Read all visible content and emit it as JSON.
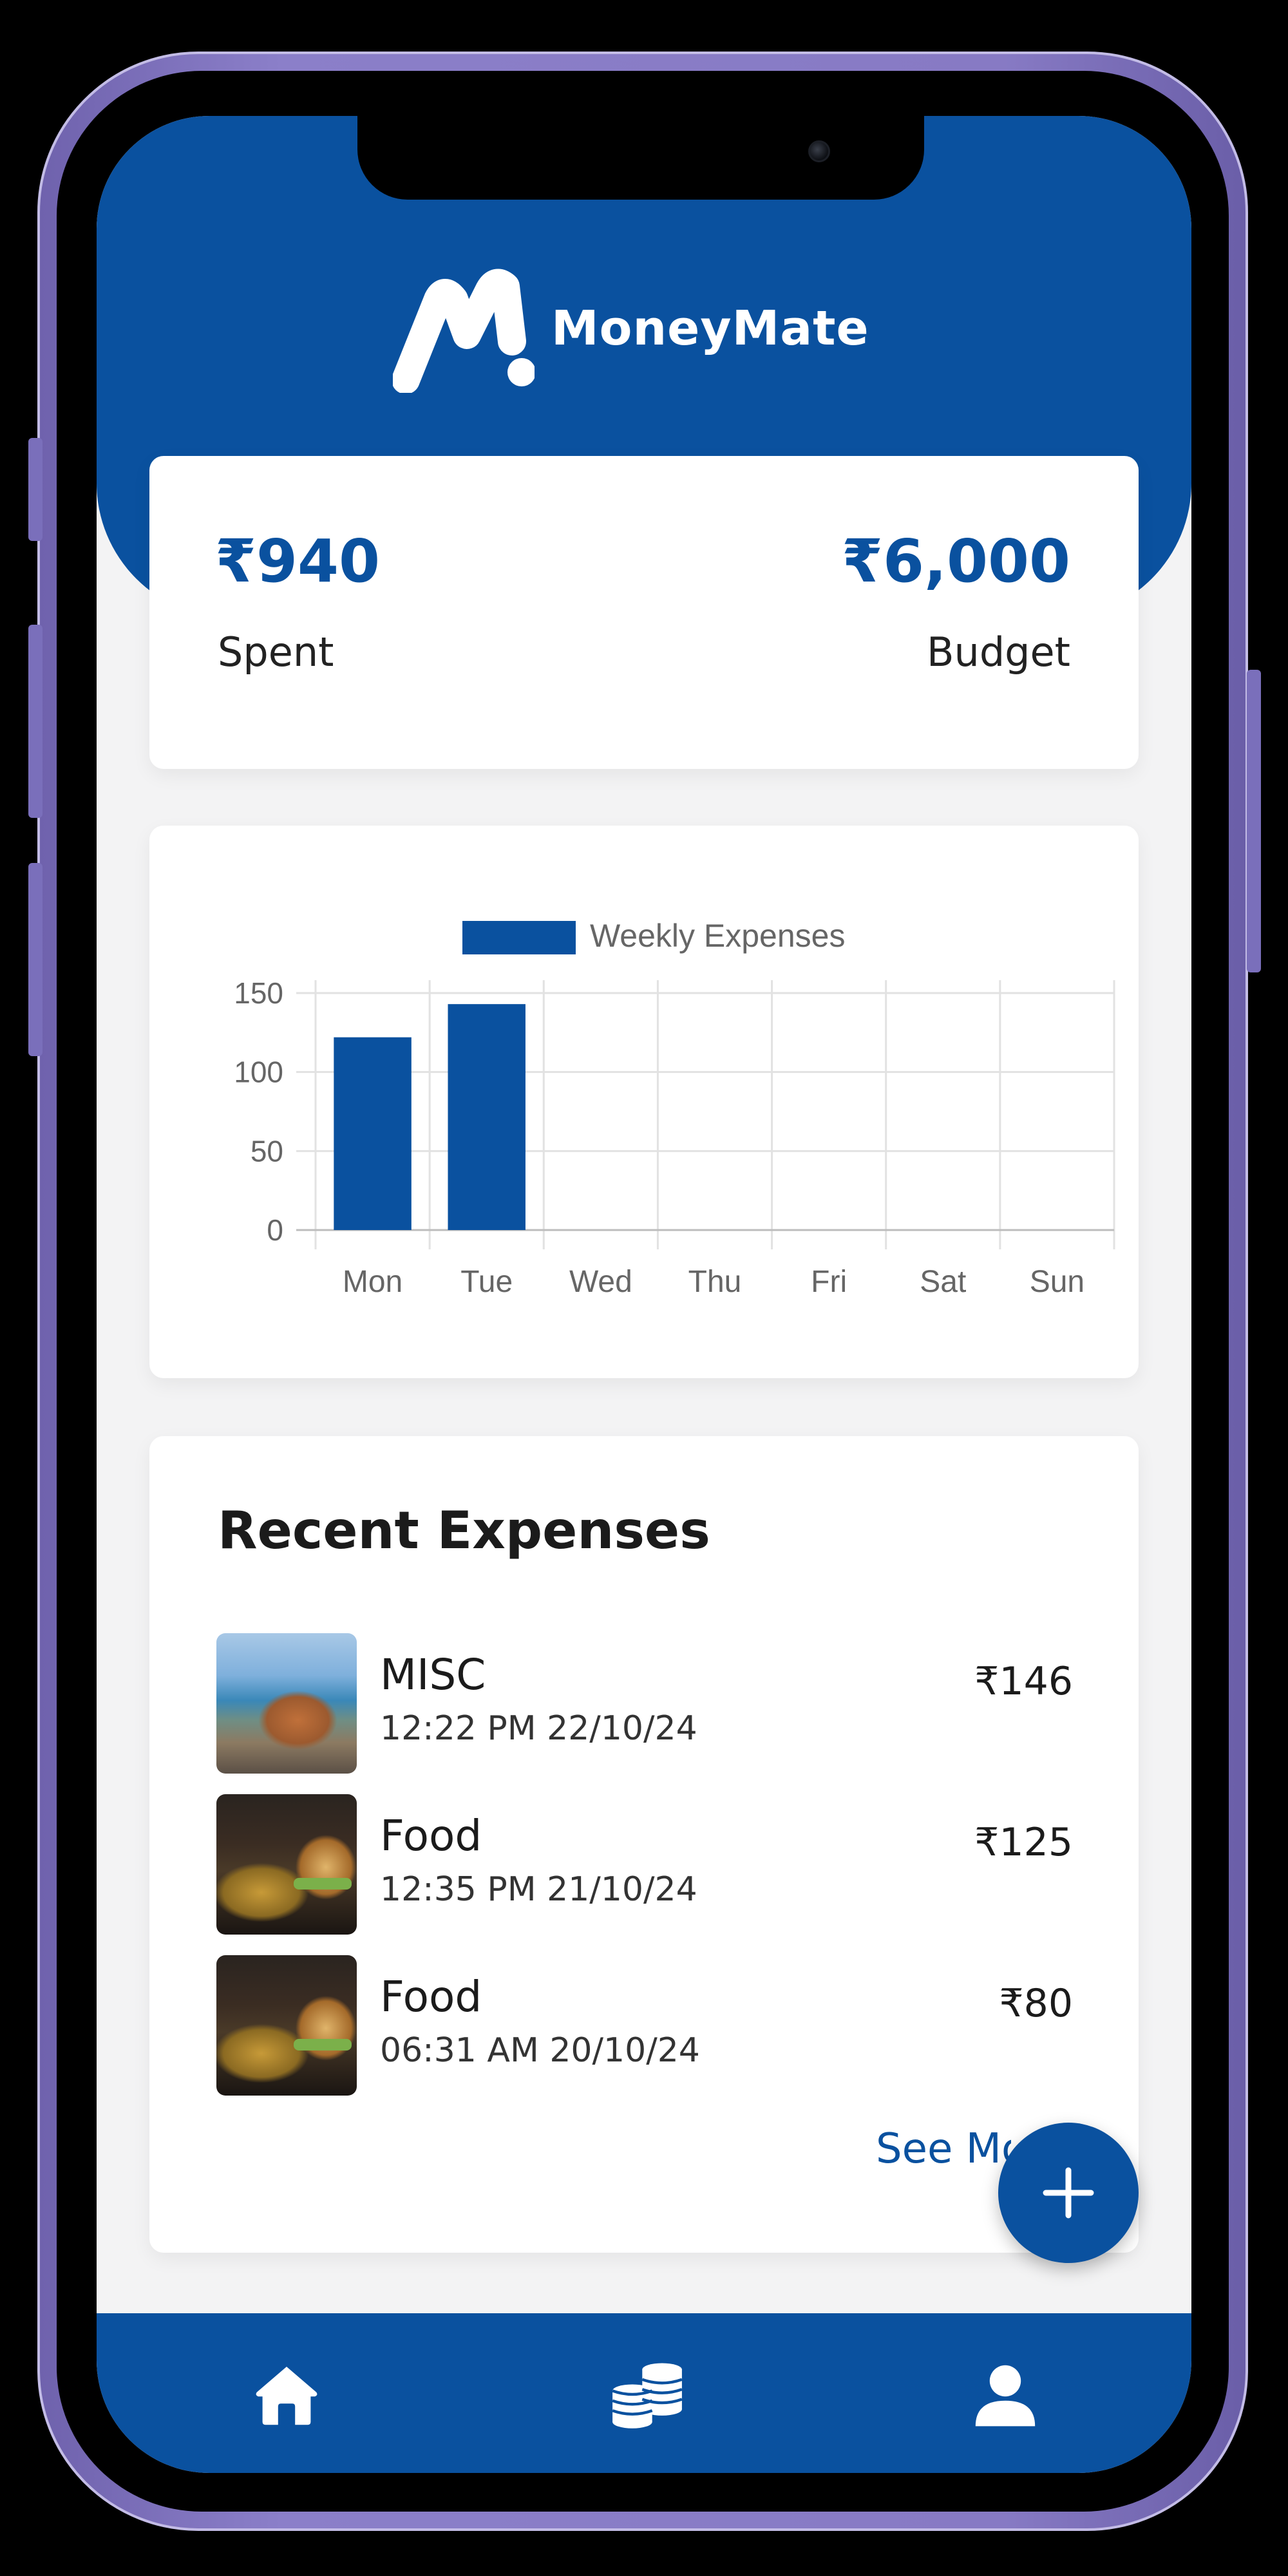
{
  "app": {
    "name": "MoneyMate"
  },
  "summary": {
    "spent_amount": "₹940",
    "spent_label": "Spent",
    "budget_amount": "₹6,000",
    "budget_label": "Budget"
  },
  "chart_data": {
    "type": "bar",
    "legend": "Weekly Expenses",
    "categories": [
      "Mon",
      "Tue",
      "Wed",
      "Thu",
      "Fri",
      "Sat",
      "Sun"
    ],
    "values": [
      122,
      143,
      0,
      0,
      0,
      0,
      0
    ],
    "ylim": [
      0,
      150
    ],
    "yticks": [
      "0",
      "50",
      "100",
      "150"
    ],
    "grid": true,
    "legend_position": "top-center",
    "color": "#0a519f"
  },
  "expenses": {
    "title": "Recent Expenses",
    "items": [
      {
        "category": "MISC",
        "time": "12:22 PM 22/10/24",
        "amount": "₹146",
        "thumb": "beach-photo"
      },
      {
        "category": "Food",
        "time": "12:35 PM 21/10/24",
        "amount": "₹125",
        "thumb": "burger-photo"
      },
      {
        "category": "Food",
        "time": "06:31 AM 20/10/24",
        "amount": "₹80",
        "thumb": "burger-photo"
      }
    ],
    "see_more": "See More"
  },
  "fab": {
    "icon": "plus-icon"
  },
  "nav": {
    "items": [
      {
        "icon": "home-icon"
      },
      {
        "icon": "coins-icon"
      },
      {
        "icon": "user-icon"
      }
    ]
  },
  "colors": {
    "primary": "#0a519f",
    "background": "#f3f3f4",
    "frame": "#877ac4"
  }
}
